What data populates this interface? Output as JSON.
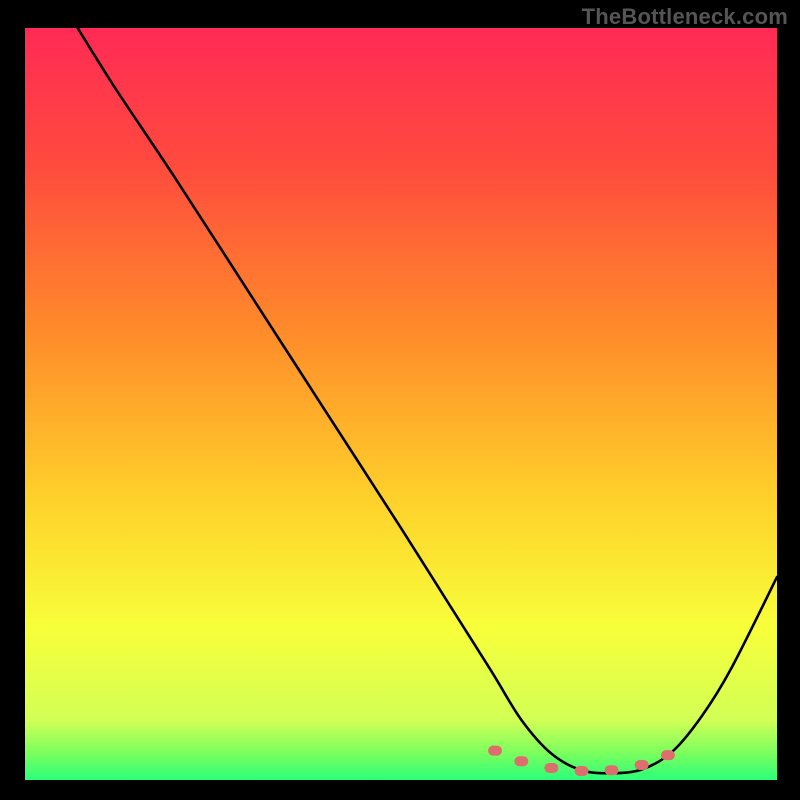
{
  "watermark": "TheBottleneck.com",
  "chart_data": {
    "type": "line",
    "title": "",
    "xlabel": "",
    "ylabel": "",
    "xlim": [
      0,
      100
    ],
    "ylim": [
      0,
      100
    ],
    "grid": false,
    "legend": false,
    "series": [
      {
        "name": "curve",
        "color": "#000000",
        "x": [
          7,
          12,
          20,
          30,
          40,
          50,
          56,
          62,
          66,
          70,
          74,
          78,
          82,
          86,
          90,
          94,
          100
        ],
        "y": [
          100,
          92,
          80,
          64.5,
          49,
          33.5,
          24,
          14.5,
          8,
          3.5,
          1.3,
          0.9,
          1.4,
          3.7,
          8.5,
          15,
          27
        ]
      },
      {
        "name": "highlight-dots",
        "color": "#de6e6e",
        "x": [
          62.5,
          66,
          70,
          74,
          78,
          82,
          85.5
        ],
        "y": [
          3.9,
          2.5,
          1.6,
          1.2,
          1.3,
          2.0,
          3.3
        ]
      }
    ],
    "gradient_stops": [
      {
        "offset": 0.0,
        "color": "#ff2a55"
      },
      {
        "offset": 0.18,
        "color": "#ff4a3e"
      },
      {
        "offset": 0.4,
        "color": "#ff8a2a"
      },
      {
        "offset": 0.62,
        "color": "#ffcf2a"
      },
      {
        "offset": 0.8,
        "color": "#f7ff3a"
      },
      {
        "offset": 0.92,
        "color": "#d2ff55"
      },
      {
        "offset": 0.965,
        "color": "#79ff5e"
      },
      {
        "offset": 1.0,
        "color": "#2bff7a"
      }
    ]
  }
}
